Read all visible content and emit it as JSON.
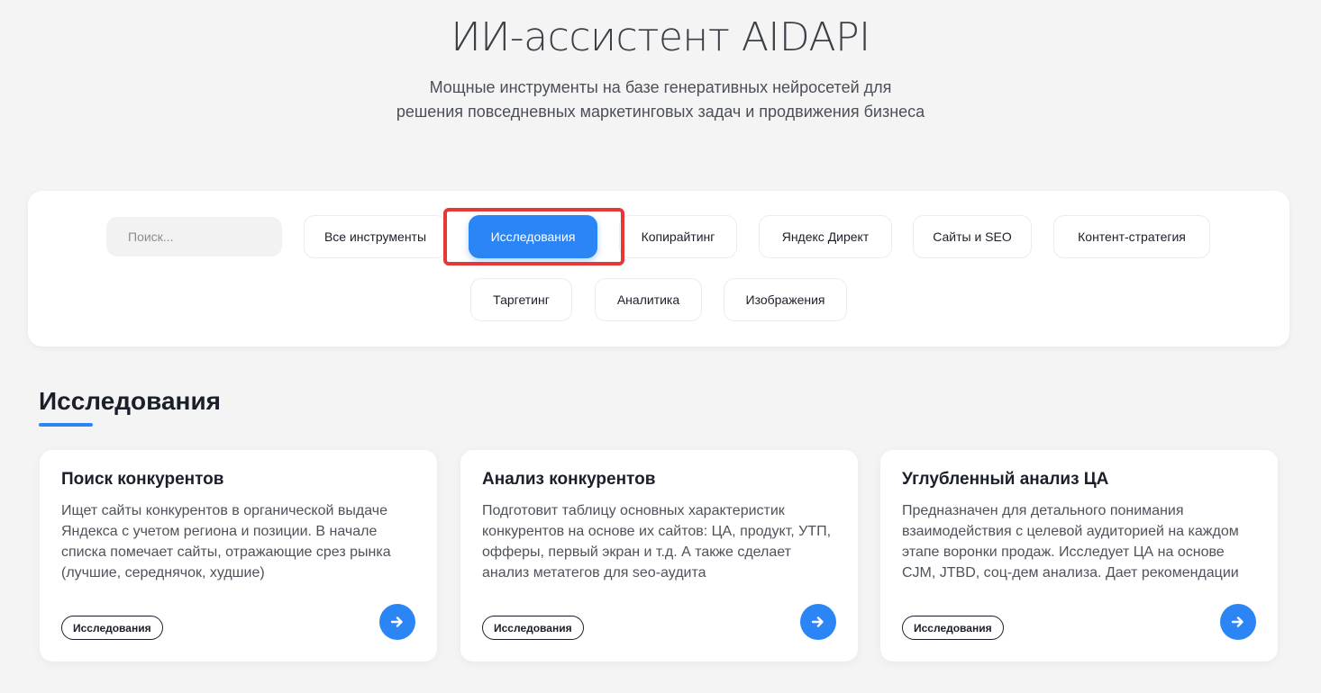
{
  "hero": {
    "title": "ИИ-ассистент AIDAPI",
    "subtitle_line1": "Мощные инструменты на базе генеративных нейросетей для",
    "subtitle_line2": "решения повседневных маркетинговых задач и продвижения бизнеса"
  },
  "filters": {
    "search_placeholder": "Поиск...",
    "search_value": "",
    "items": [
      {
        "label": "Все инструменты",
        "active": false
      },
      {
        "label": "Исследования",
        "active": true
      },
      {
        "label": "Копирайтинг",
        "active": false
      },
      {
        "label": "Яндекс Директ",
        "active": false
      },
      {
        "label": "Сайты и SEO",
        "active": false
      },
      {
        "label": "Контент-стратегия",
        "active": false
      },
      {
        "label": "Таргетинг",
        "active": false
      },
      {
        "label": "Аналитика",
        "active": false
      },
      {
        "label": "Изображения",
        "active": false
      }
    ]
  },
  "section": {
    "title": "Исследования"
  },
  "cards": [
    {
      "title": "Поиск конкурентов",
      "description": "Ищет сайты конкурентов в органической выдаче Яндекса с учетом региона и позиции. В начале списка помечает сайты, отражающие срез рынка (лучшие, середнячок, худшие)",
      "tag": "Исследования",
      "action_icon": "arrow-right-icon"
    },
    {
      "title": "Анализ конкурентов",
      "description": "Подготовит таблицу основных характеристик конкурентов на основе их сайтов: ЦА, продукт, УТП, офферы, первый экран и т.д. А также сделает анализ метатегов для seo-аудита",
      "tag": "Исследования",
      "action_icon": "arrow-right-icon"
    },
    {
      "title": "Углубленный анализ ЦА",
      "description": "Предназначен для детального понимания взаимодействия с целевой аудиторией на каждом этапе воронки продаж. Исследует ЦА на основе CJM, JTBD, соц-дем анализа. Дает рекомендации",
      "tag": "Исследования",
      "action_icon": "arrow-right-icon"
    }
  ],
  "colors": {
    "accent": "#2b85f4",
    "highlight": "#e53935",
    "background": "#f4f4f4"
  }
}
